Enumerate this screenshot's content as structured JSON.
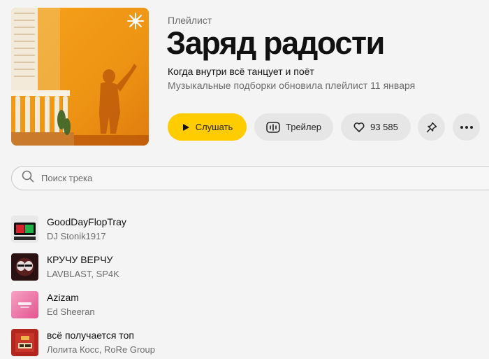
{
  "header": {
    "eyebrow": "Плейлист",
    "title": "Заряд радости",
    "description": "Когда внутри всё танцует и поёт",
    "updated": "Музыкальные подборки обновила плейлист 11 января"
  },
  "actions": {
    "listen_label": "Слушать",
    "trailer_label": "Трейлер",
    "like_count": "93 585",
    "accent_color": "#ffcc00"
  },
  "search": {
    "placeholder": "Поиск трека",
    "value": ""
  },
  "tracks": [
    {
      "title": "GoodDayFlopTray",
      "artist": "DJ Stonik1917"
    },
    {
      "title": "КРУЧУ ВЕРЧУ",
      "artist": "LAVBLAST, SP4K"
    },
    {
      "title": "Azizam",
      "artist": "Ed Sheeran"
    },
    {
      "title": "всё получается топ",
      "artist": "Лолита Косс, RoRe Group"
    }
  ],
  "icons": {
    "play": "play-icon",
    "trailer": "waveform-icon",
    "like": "heart-icon",
    "pin": "pin-icon",
    "more": "more-icon",
    "search": "search-icon"
  }
}
